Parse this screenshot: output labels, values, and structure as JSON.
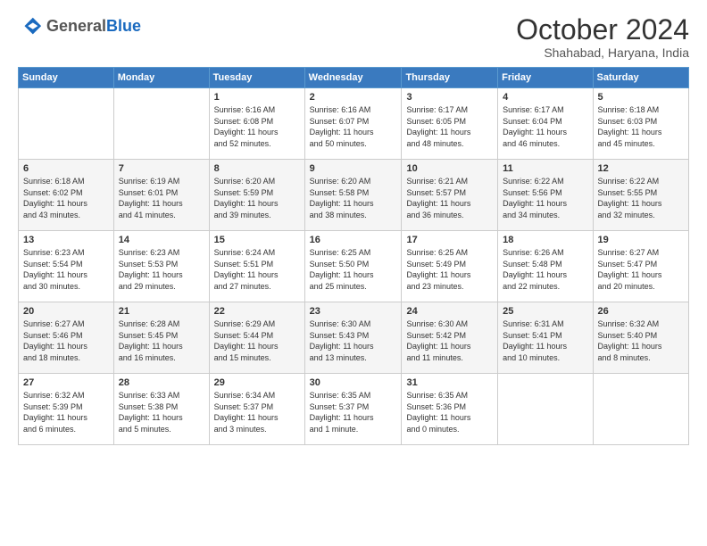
{
  "header": {
    "logo": {
      "general": "General",
      "blue": "Blue"
    },
    "title": "October 2024",
    "location": "Shahabad, Haryana, India"
  },
  "calendar": {
    "days_of_week": [
      "Sunday",
      "Monday",
      "Tuesday",
      "Wednesday",
      "Thursday",
      "Friday",
      "Saturday"
    ],
    "weeks": [
      [
        {
          "day": "",
          "info": ""
        },
        {
          "day": "",
          "info": ""
        },
        {
          "day": "1",
          "info": "Sunrise: 6:16 AM\nSunset: 6:08 PM\nDaylight: 11 hours\nand 52 minutes."
        },
        {
          "day": "2",
          "info": "Sunrise: 6:16 AM\nSunset: 6:07 PM\nDaylight: 11 hours\nand 50 minutes."
        },
        {
          "day": "3",
          "info": "Sunrise: 6:17 AM\nSunset: 6:05 PM\nDaylight: 11 hours\nand 48 minutes."
        },
        {
          "day": "4",
          "info": "Sunrise: 6:17 AM\nSunset: 6:04 PM\nDaylight: 11 hours\nand 46 minutes."
        },
        {
          "day": "5",
          "info": "Sunrise: 6:18 AM\nSunset: 6:03 PM\nDaylight: 11 hours\nand 45 minutes."
        }
      ],
      [
        {
          "day": "6",
          "info": "Sunrise: 6:18 AM\nSunset: 6:02 PM\nDaylight: 11 hours\nand 43 minutes."
        },
        {
          "day": "7",
          "info": "Sunrise: 6:19 AM\nSunset: 6:01 PM\nDaylight: 11 hours\nand 41 minutes."
        },
        {
          "day": "8",
          "info": "Sunrise: 6:20 AM\nSunset: 5:59 PM\nDaylight: 11 hours\nand 39 minutes."
        },
        {
          "day": "9",
          "info": "Sunrise: 6:20 AM\nSunset: 5:58 PM\nDaylight: 11 hours\nand 38 minutes."
        },
        {
          "day": "10",
          "info": "Sunrise: 6:21 AM\nSunset: 5:57 PM\nDaylight: 11 hours\nand 36 minutes."
        },
        {
          "day": "11",
          "info": "Sunrise: 6:22 AM\nSunset: 5:56 PM\nDaylight: 11 hours\nand 34 minutes."
        },
        {
          "day": "12",
          "info": "Sunrise: 6:22 AM\nSunset: 5:55 PM\nDaylight: 11 hours\nand 32 minutes."
        }
      ],
      [
        {
          "day": "13",
          "info": "Sunrise: 6:23 AM\nSunset: 5:54 PM\nDaylight: 11 hours\nand 30 minutes."
        },
        {
          "day": "14",
          "info": "Sunrise: 6:23 AM\nSunset: 5:53 PM\nDaylight: 11 hours\nand 29 minutes."
        },
        {
          "day": "15",
          "info": "Sunrise: 6:24 AM\nSunset: 5:51 PM\nDaylight: 11 hours\nand 27 minutes."
        },
        {
          "day": "16",
          "info": "Sunrise: 6:25 AM\nSunset: 5:50 PM\nDaylight: 11 hours\nand 25 minutes."
        },
        {
          "day": "17",
          "info": "Sunrise: 6:25 AM\nSunset: 5:49 PM\nDaylight: 11 hours\nand 23 minutes."
        },
        {
          "day": "18",
          "info": "Sunrise: 6:26 AM\nSunset: 5:48 PM\nDaylight: 11 hours\nand 22 minutes."
        },
        {
          "day": "19",
          "info": "Sunrise: 6:27 AM\nSunset: 5:47 PM\nDaylight: 11 hours\nand 20 minutes."
        }
      ],
      [
        {
          "day": "20",
          "info": "Sunrise: 6:27 AM\nSunset: 5:46 PM\nDaylight: 11 hours\nand 18 minutes."
        },
        {
          "day": "21",
          "info": "Sunrise: 6:28 AM\nSunset: 5:45 PM\nDaylight: 11 hours\nand 16 minutes."
        },
        {
          "day": "22",
          "info": "Sunrise: 6:29 AM\nSunset: 5:44 PM\nDaylight: 11 hours\nand 15 minutes."
        },
        {
          "day": "23",
          "info": "Sunrise: 6:30 AM\nSunset: 5:43 PM\nDaylight: 11 hours\nand 13 minutes."
        },
        {
          "day": "24",
          "info": "Sunrise: 6:30 AM\nSunset: 5:42 PM\nDaylight: 11 hours\nand 11 minutes."
        },
        {
          "day": "25",
          "info": "Sunrise: 6:31 AM\nSunset: 5:41 PM\nDaylight: 11 hours\nand 10 minutes."
        },
        {
          "day": "26",
          "info": "Sunrise: 6:32 AM\nSunset: 5:40 PM\nDaylight: 11 hours\nand 8 minutes."
        }
      ],
      [
        {
          "day": "27",
          "info": "Sunrise: 6:32 AM\nSunset: 5:39 PM\nDaylight: 11 hours\nand 6 minutes."
        },
        {
          "day": "28",
          "info": "Sunrise: 6:33 AM\nSunset: 5:38 PM\nDaylight: 11 hours\nand 5 minutes."
        },
        {
          "day": "29",
          "info": "Sunrise: 6:34 AM\nSunset: 5:37 PM\nDaylight: 11 hours\nand 3 minutes."
        },
        {
          "day": "30",
          "info": "Sunrise: 6:35 AM\nSunset: 5:37 PM\nDaylight: 11 hours\nand 1 minute."
        },
        {
          "day": "31",
          "info": "Sunrise: 6:35 AM\nSunset: 5:36 PM\nDaylight: 11 hours\nand 0 minutes."
        },
        {
          "day": "",
          "info": ""
        },
        {
          "day": "",
          "info": ""
        }
      ]
    ]
  }
}
